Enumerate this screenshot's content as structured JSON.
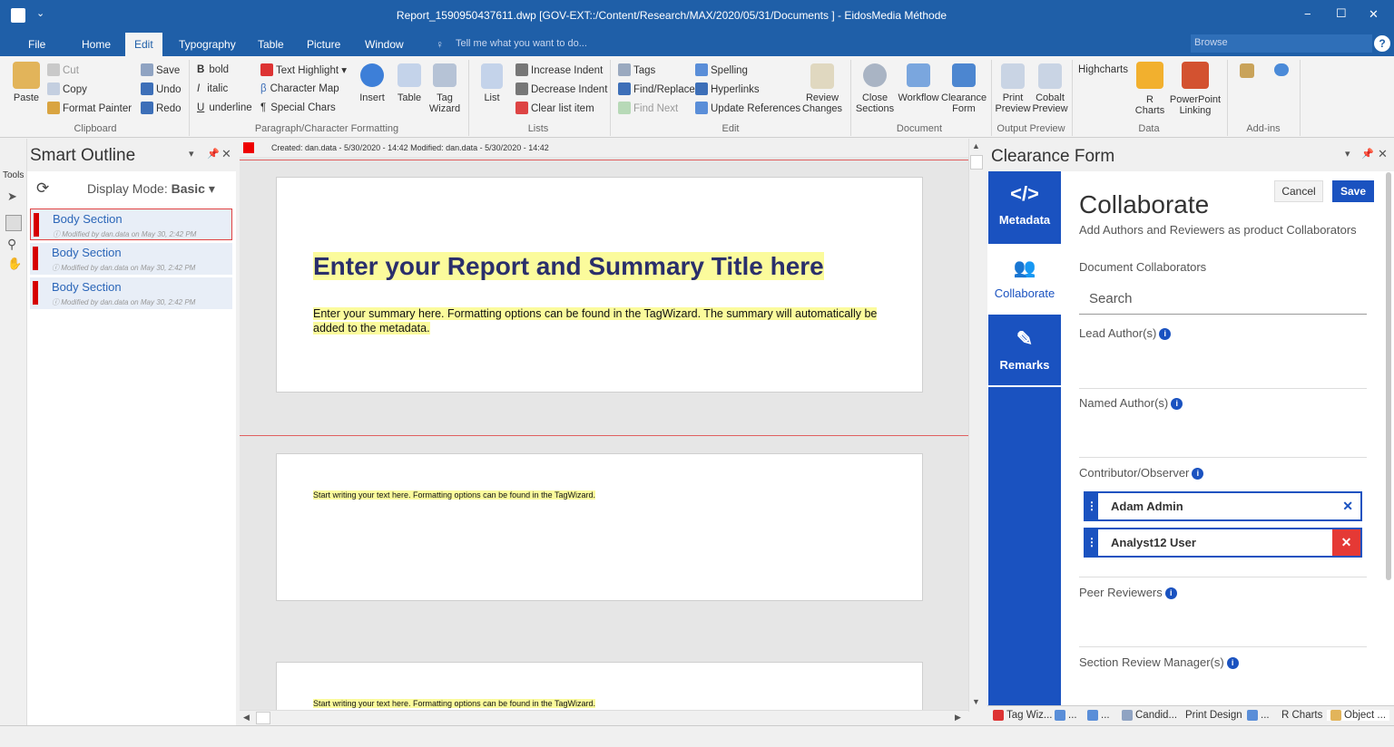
{
  "window": {
    "title": "Report_1590950437611.dwp  [GOV-EXT::/Content/Research/MAX/2020/05/31/Documents ] - EidosMedia Méthode",
    "minimize": "−",
    "maximize": "☐",
    "close": "✕"
  },
  "menu": {
    "tabs": [
      "File",
      "Home",
      "Edit",
      "Typography",
      "Table",
      "Picture",
      "Window"
    ],
    "tell_me": "Tell me what you want to do...",
    "browse_placeholder": "Browse",
    "help": "?"
  },
  "ribbon": {
    "clipboard": {
      "paste": "Paste",
      "cut": "Cut",
      "copy": "Copy",
      "format_painter": "Format Painter",
      "save": "Save",
      "undo": "Undo",
      "redo": "Redo",
      "group": "Clipboard"
    },
    "format": {
      "bold": "bold",
      "italic": "italic",
      "underline": "underline",
      "text_highlight": "Text Highlight",
      "character_map": "Character Map",
      "special_chars": "Special Chars",
      "insert": "Insert",
      "table": "Table",
      "tag_wizard_1": "Tag",
      "tag_wizard_2": "Wizard",
      "group": "Paragraph/Character Formatting"
    },
    "lists": {
      "list": "List",
      "increase_indent": "Increase Indent",
      "decrease_indent": "Decrease Indent",
      "clear_list_item": "Clear list item",
      "group": "Lists"
    },
    "edit": {
      "tags": "Tags",
      "find_replace": "Find/Replace",
      "find_next": "Find Next",
      "spelling": "Spelling",
      "hyperlinks": "Hyperlinks",
      "update_references": "Update References",
      "review_1": "Review",
      "review_2": "Changes",
      "group": "Edit"
    },
    "document": {
      "close_1": "Close",
      "close_2": "Sections",
      "workflow": "Workflow",
      "clearance_1": "Clearance",
      "clearance_2": "Form",
      "group": "Document"
    },
    "output": {
      "print_1": "Print",
      "print_2": "Preview",
      "cobalt_1": "Cobalt",
      "cobalt_2": "Preview",
      "group": "Output Preview"
    },
    "data": {
      "highcharts": "Highcharts",
      "r_1": "R",
      "r_2": "Charts",
      "ppt_1": "PowerPoint",
      "ppt_2": "Linking",
      "group": "Data"
    },
    "addins": {
      "group": "Add-ins"
    }
  },
  "left_tools": {
    "label": "Tools"
  },
  "outline": {
    "title": "Smart Outline",
    "display_mode_label": "Display Mode:",
    "display_mode_value": "Basic",
    "items": [
      {
        "label": "Body Section",
        "meta": "Modified by dan.data on May 30, 2:42 PM"
      },
      {
        "label": "Body Section",
        "meta": "Modified by dan.data on May 30, 2:42 PM"
      },
      {
        "label": "Body Section",
        "meta": "Modified by dan.data on May 30, 2:42 PM"
      }
    ]
  },
  "document": {
    "header": "Created: dan.data - 5/30/2020 - 14:42   Modified: dan.data - 5/30/2020 - 14:42",
    "title": "Enter your Report and Summary Title here",
    "summary": "Enter your summary here. Formatting options can be found in the TagWizard. The summary will automatically be added to the metadata.",
    "body_prompt": "Start writing your text here. Formatting options can be found in the TagWizard."
  },
  "clearance": {
    "panel_title": "Clearance Form",
    "nav": [
      {
        "icon": "code-icon",
        "label": "Metadata"
      },
      {
        "icon": "users-icon",
        "label": "Collaborate"
      },
      {
        "icon": "remarks-icon",
        "label": "Remarks"
      }
    ],
    "heading": "Collaborate",
    "subheading": "Add Authors and Reviewers as product Collaborators",
    "cancel": "Cancel",
    "save": "Save",
    "doc_collaborators": "Document Collaborators",
    "search_placeholder": "Search",
    "lead_authors": "Lead Author(s)",
    "named_authors": "Named Author(s)",
    "contributor": "Contributor/Observer",
    "contributors": [
      "Adam Admin",
      "Analyst12 User"
    ],
    "peer_reviewers": "Peer Reviewers",
    "section_review": "Section Review Manager(s)"
  },
  "bottom_tabs": [
    "Tag Wiz...",
    "...",
    "...",
    "Candid...",
    "Print Design",
    "...",
    "R Charts",
    "Object ..."
  ]
}
